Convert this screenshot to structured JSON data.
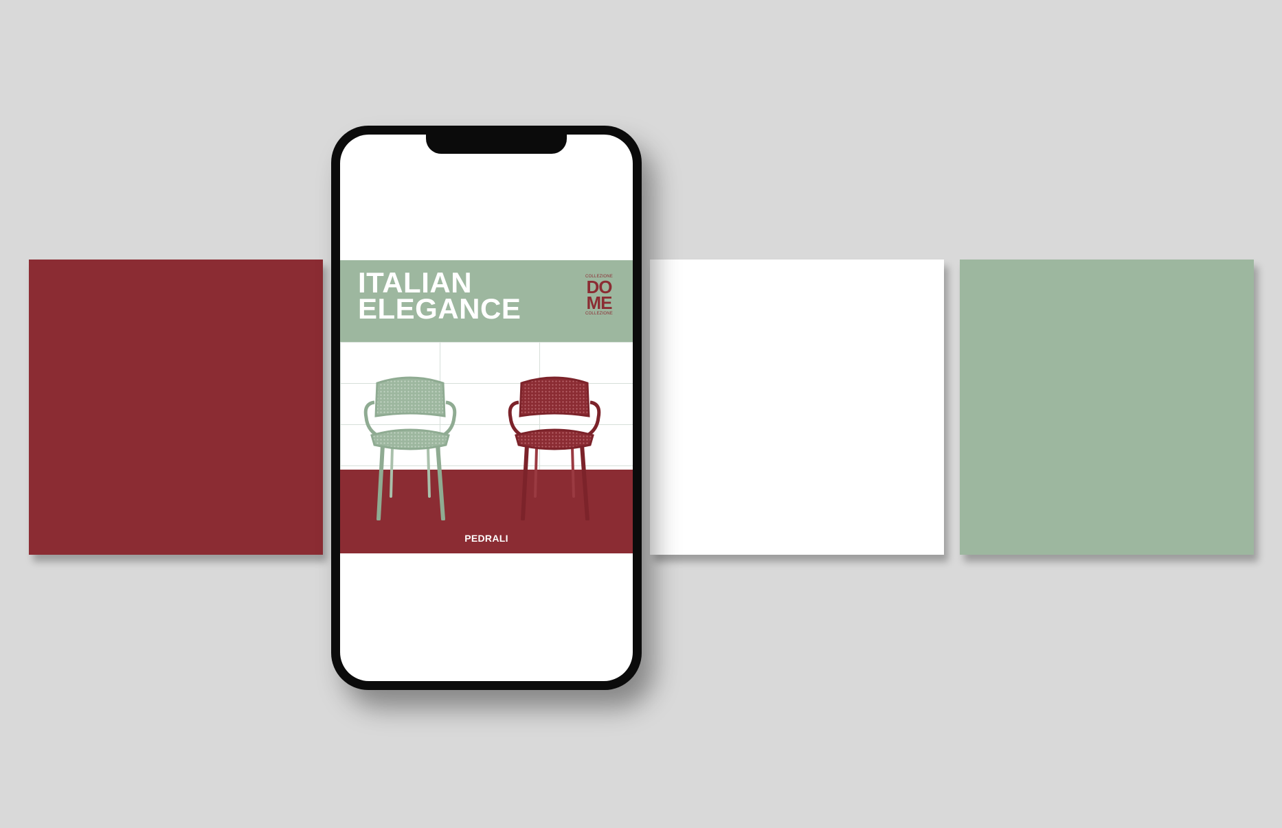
{
  "colors": {
    "background": "#d9d9d9",
    "red": "#8b2c33",
    "white": "#ffffff",
    "green": "#9db79f",
    "phone_frame": "#0b0b0b"
  },
  "poster": {
    "headline_line1": "ITALIAN",
    "headline_line2": "ELEGANCE",
    "collection_top": "COLLEZIONE",
    "logo_line1": "DO",
    "logo_line2": "ME",
    "collection_bottom": "COLLEZIONE",
    "brand": "PEDRALI"
  },
  "icons": {
    "chair_green": "chair-icon",
    "chair_red": "chair-icon"
  }
}
